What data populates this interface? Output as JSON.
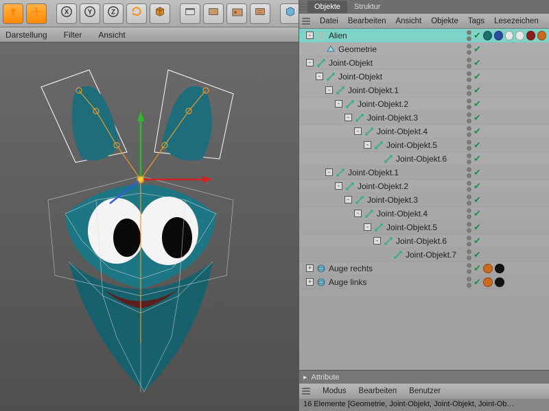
{
  "top_icons": [
    "up",
    "move",
    "x",
    "y",
    "z",
    "rotate1",
    "cube",
    "film1",
    "film2",
    "film3",
    "film4",
    "prim",
    "render1",
    "render2"
  ],
  "viewmenu": {
    "items": [
      "Darstellung",
      "Filter",
      "Ansicht"
    ]
  },
  "panel": {
    "tabs": [
      "Objekte",
      "Struktur"
    ],
    "menu": [
      "Datei",
      "Bearbeiten",
      "Ansicht",
      "Objekte",
      "Tags",
      "Lesezeichen"
    ]
  },
  "tree": [
    {
      "d": 0,
      "exp": "-",
      "icon": "null",
      "label": "Alien",
      "sel": true,
      "tags": [
        "teal",
        "blue",
        "white",
        "white",
        "red",
        "orange"
      ]
    },
    {
      "d": 1,
      "exp": "",
      "icon": "poly",
      "label": "Geometrie"
    },
    {
      "d": 0,
      "exp": "-",
      "icon": "joint",
      "label": "Joint-Objekt"
    },
    {
      "d": 1,
      "exp": "-",
      "icon": "joint",
      "label": "Joint-Objekt"
    },
    {
      "d": 2,
      "exp": "-",
      "icon": "joint",
      "label": "Joint-Objekt.1"
    },
    {
      "d": 3,
      "exp": "-",
      "icon": "joint",
      "label": "Joint-Objekt.2"
    },
    {
      "d": 4,
      "exp": "-",
      "icon": "joint",
      "label": "Joint-Objekt.3"
    },
    {
      "d": 5,
      "exp": "-",
      "icon": "joint",
      "label": "Joint-Objekt.4"
    },
    {
      "d": 6,
      "exp": "-",
      "icon": "joint",
      "label": "Joint-Objekt.5"
    },
    {
      "d": 7,
      "exp": "",
      "icon": "joint",
      "label": "Joint-Objekt.6"
    },
    {
      "d": 2,
      "exp": "-",
      "icon": "joint",
      "label": "Joint-Objekt.1"
    },
    {
      "d": 3,
      "exp": "-",
      "icon": "joint",
      "label": "Joint-Objekt.2"
    },
    {
      "d": 4,
      "exp": "-",
      "icon": "joint",
      "label": "Joint-Objekt.3"
    },
    {
      "d": 5,
      "exp": "-",
      "icon": "joint",
      "label": "Joint-Objekt.4"
    },
    {
      "d": 6,
      "exp": "-",
      "icon": "joint",
      "label": "Joint-Objekt.5"
    },
    {
      "d": 7,
      "exp": "-",
      "icon": "joint",
      "label": "Joint-Objekt.6"
    },
    {
      "d": 8,
      "exp": "",
      "icon": "joint",
      "label": "Joint-Objekt.7"
    },
    {
      "d": 0,
      "exp": "+",
      "icon": "sphere",
      "label": "Auge rechts",
      "tags": [
        "orange",
        "black"
      ]
    },
    {
      "d": 0,
      "exp": "+",
      "icon": "sphere",
      "label": "Auge links",
      "tags": [
        "orange",
        "black"
      ]
    }
  ],
  "attributes": {
    "title": "Attribute",
    "menu": [
      "Modus",
      "Bearbeiten",
      "Benutzer"
    ]
  },
  "status": "16 Elemente [Geometrie, Joint-Objekt, Joint-Objekt, Joint-Ob…",
  "tagcolors": {
    "teal": "#1b6f6f",
    "blue": "#2b4fa0",
    "white": "#e8e8e8",
    "red": "#8a1f1f",
    "orange": "#c96a1f",
    "black": "#111"
  }
}
